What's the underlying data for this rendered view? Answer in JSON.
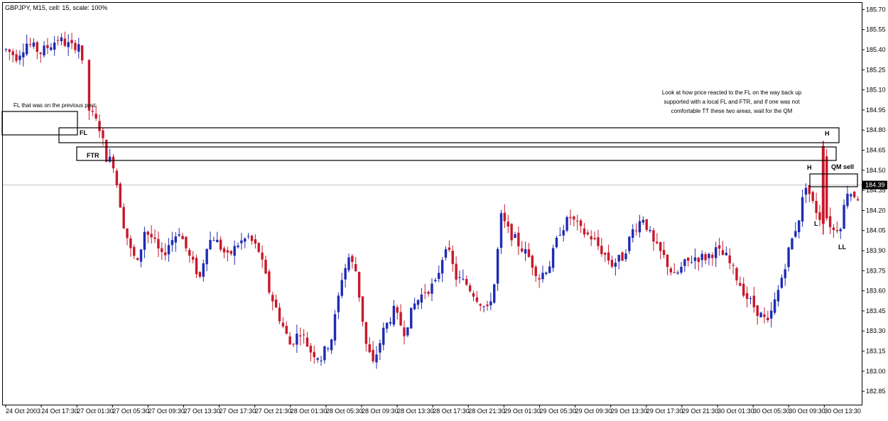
{
  "chart_data": {
    "type": "candlestick",
    "title": "GBPJPY, M15, cell: 15, scale: 100%",
    "current_price": "184.39",
    "ylim": [
      182.75,
      185.75
    ],
    "y_ticks": [
      "185.70",
      "185.55",
      "185.40",
      "185.25",
      "185.10",
      "184.95",
      "184.80",
      "184.65",
      "184.50",
      "184.35",
      "184.20",
      "184.05",
      "183.90",
      "183.75",
      "183.60",
      "183.45",
      "183.30",
      "183.15",
      "183.00",
      "182.85"
    ],
    "x_ticks": [
      "24 Oct 2003",
      "24 Oct 17:30",
      "27 Oct 01:30",
      "27 Oct 05:30",
      "27 Oct 09:30",
      "27 Oct 13:30",
      "27 Oct 17:30",
      "27 Oct 21:30",
      "28 Oct 01:30",
      "28 Oct 05:30",
      "28 Oct 09:30",
      "28 Oct 13:30",
      "28 Oct 17:30",
      "28 Oct 21:30",
      "29 Oct 01:30",
      "29 Oct 05:30",
      "29 Oct 09:30",
      "29 Oct 13:30",
      "29 Oct 17:30",
      "29 Oct 21:30",
      "30 Oct 01:30",
      "30 Oct 05:30",
      "30 Oct 09:30",
      "30 Oct 13:30"
    ],
    "price_path": [
      [
        0,
        185.4
      ],
      [
        3,
        185.35
      ],
      [
        6,
        185.45
      ],
      [
        10,
        185.38
      ],
      [
        15,
        185.48
      ],
      [
        19,
        185.42
      ],
      [
        21,
        185.45
      ],
      [
        24,
        184.95
      ],
      [
        27,
        184.82
      ],
      [
        29,
        184.6
      ],
      [
        31,
        184.55
      ],
      [
        34,
        184.1
      ],
      [
        36,
        183.9
      ],
      [
        38,
        183.8
      ],
      [
        40,
        184.05
      ],
      [
        42,
        184.0
      ],
      [
        45,
        183.85
      ],
      [
        47,
        183.95
      ],
      [
        50,
        184.05
      ],
      [
        53,
        183.85
      ],
      [
        56,
        183.7
      ],
      [
        58,
        183.95
      ],
      [
        60,
        184.0
      ],
      [
        64,
        183.85
      ],
      [
        67,
        183.95
      ],
      [
        70,
        184.0
      ],
      [
        73,
        183.9
      ],
      [
        76,
        183.6
      ],
      [
        79,
        183.4
      ],
      [
        82,
        183.2
      ],
      [
        85,
        183.3
      ],
      [
        88,
        183.15
      ],
      [
        91,
        183.1
      ],
      [
        94,
        183.25
      ],
      [
        97,
        183.7
      ],
      [
        99,
        183.85
      ],
      [
        101,
        183.75
      ],
      [
        104,
        183.2
      ],
      [
        106,
        183.05
      ],
      [
        109,
        183.3
      ],
      [
        112,
        183.45
      ],
      [
        115,
        183.3
      ],
      [
        118,
        183.5
      ],
      [
        121,
        183.6
      ],
      [
        124,
        183.65
      ],
      [
        127,
        183.95
      ],
      [
        130,
        183.7
      ],
      [
        133,
        183.65
      ],
      [
        136,
        183.55
      ],
      [
        139,
        183.45
      ],
      [
        141,
        183.65
      ],
      [
        143,
        184.15
      ],
      [
        145,
        184.05
      ],
      [
        148,
        183.95
      ],
      [
        151,
        183.85
      ],
      [
        154,
        183.7
      ],
      [
        157,
        183.8
      ],
      [
        160,
        184.05
      ],
      [
        163,
        184.15
      ],
      [
        166,
        184.05
      ],
      [
        169,
        184.0
      ],
      [
        172,
        183.9
      ],
      [
        175,
        183.8
      ],
      [
        178,
        183.85
      ],
      [
        181,
        184.05
      ],
      [
        184,
        184.15
      ],
      [
        187,
        183.95
      ],
      [
        190,
        183.85
      ],
      [
        193,
        183.7
      ],
      [
        196,
        183.8
      ],
      [
        199,
        183.85
      ],
      [
        202,
        183.85
      ],
      [
        205,
        183.9
      ],
      [
        208,
        183.85
      ],
      [
        211,
        183.7
      ],
      [
        214,
        183.55
      ],
      [
        217,
        183.45
      ],
      [
        220,
        183.35
      ],
      [
        223,
        183.6
      ],
      [
        226,
        183.9
      ],
      [
        229,
        184.15
      ],
      [
        231,
        184.4
      ],
      [
        233,
        184.25
      ],
      [
        235,
        184.15
      ],
      [
        236,
        184.65
      ],
      [
        237,
        184.15
      ],
      [
        239,
        184.05
      ],
      [
        241,
        184.1
      ],
      [
        243,
        184.35
      ],
      [
        246,
        184.3
      ]
    ],
    "annotations": {
      "fl_prev_label": "FL that was on the previous post",
      "fl_label": "FL",
      "ftr_label": "FTR",
      "note_line1": "Look at how price reacted to the FL on the way back up",
      "note_line2": "supported with a local FL and FTR, and if one was not",
      "note_line3": "comfortable TT these two areas, wait for the QM",
      "h1": "H",
      "h2": "H",
      "qm_sell": "QM sell",
      "l_label": "L",
      "ll_label": "LL"
    },
    "colors": {
      "bull": "#1f2bb3",
      "bear": "#c8182b",
      "box": "#000000",
      "current_line": "#c0c0c0"
    }
  }
}
